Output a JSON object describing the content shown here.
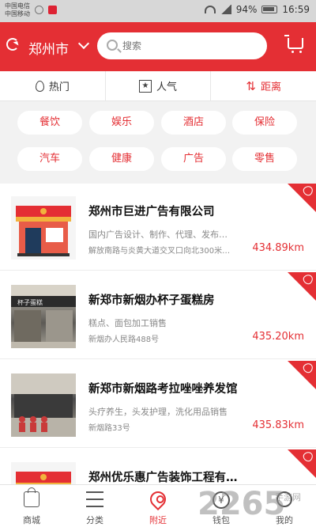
{
  "status_bar": {
    "carrier_1": "中国电信",
    "carrier_2": "中国移动",
    "battery": "94%",
    "time": "16:59"
  },
  "header": {
    "city": "郑州市",
    "search_placeholder": "搜索"
  },
  "sort_tabs": [
    {
      "label": "热门"
    },
    {
      "label": "人气"
    },
    {
      "label": "距离"
    }
  ],
  "categories": [
    "餐饮",
    "娱乐",
    "酒店",
    "保险",
    "汽车",
    "健康",
    "广告",
    "零售"
  ],
  "shops": [
    {
      "name": "郑州市巨进广告有限公司",
      "desc": "国内广告设计、制作、代理、发布…",
      "address": "解放南路与炎黄大道交叉口向北300米…",
      "distance": "434.89km"
    },
    {
      "name": "新郑市新烟办杯子蛋糕房",
      "desc": "糕点、面包加工销售",
      "address": "新烟办人民路488号",
      "distance": "435.20km"
    },
    {
      "name": "新郑市新烟路考拉唑唑养发馆",
      "desc": "头疗养生，头发护理，洗化用品销售",
      "address": "新烟路33号",
      "distance": "435.83km"
    },
    {
      "name": "郑州优乐惠广告装饰工程有…",
      "desc": "",
      "address": "",
      "distance": ""
    }
  ],
  "tab_bar": [
    {
      "label": "商城",
      "icon": "bag-icon"
    },
    {
      "label": "分类",
      "icon": "menu-icon"
    },
    {
      "label": "附近",
      "icon": "location-pin-icon"
    },
    {
      "label": "钱包",
      "icon": "wallet-icon"
    },
    {
      "label": "我的",
      "icon": "user-icon"
    }
  ],
  "watermark": {
    "text": "2265",
    "sub": "手游网"
  },
  "colors": {
    "accent": "#e42f34",
    "background": "#f2f2f2"
  }
}
